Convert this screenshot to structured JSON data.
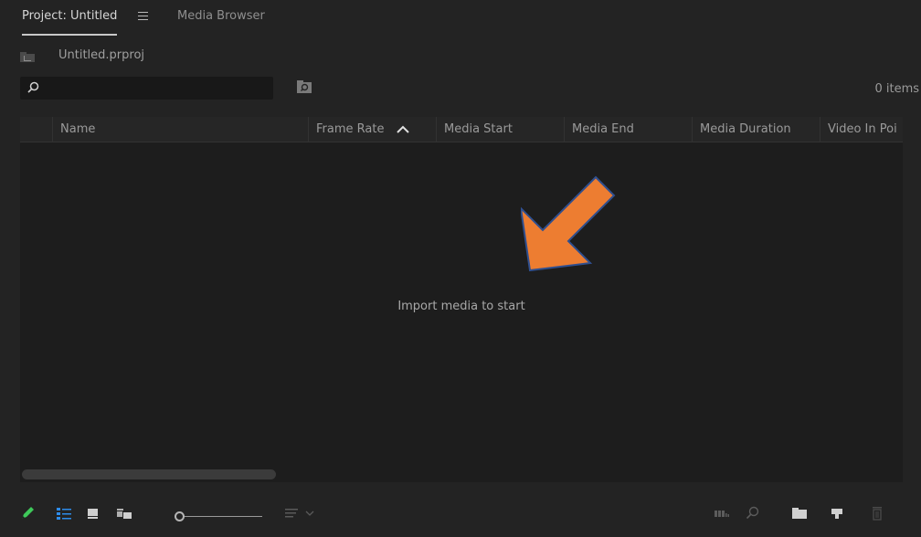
{
  "tabs": {
    "project_label": "Project: Untitled",
    "media_browser_label": "Media Browser"
  },
  "breadcrumb": {
    "project_file": "Untitled.prproj"
  },
  "search": {
    "value": "",
    "placeholder": ""
  },
  "items_count": "0 items",
  "columns": {
    "name": "Name",
    "frame_rate": "Frame Rate",
    "media_start": "Media Start",
    "media_end": "Media End",
    "media_duration": "Media Duration",
    "video_in_point": "Video In Poi"
  },
  "sort": {
    "column": "Frame Rate",
    "direction": "ascending"
  },
  "empty_message": "Import media to start",
  "annotation": {
    "icon": "arrow-down-left",
    "color": "#ed7d31",
    "outline": "#2f4f8f"
  },
  "toolbar": {
    "icons": [
      "pencil-icon",
      "list-view-icon",
      "icon-view-icon",
      "freeform-view-icon",
      "zoom-slider",
      "sort-icons-icon",
      "automate-to-sequence-icon",
      "find-icon",
      "new-bin-icon",
      "new-item-icon",
      "trash-icon"
    ],
    "zoom_level": 0
  },
  "colors": {
    "background": "#232323",
    "list_background": "#1d1d1d",
    "accent_green": "#3ec95a",
    "accent_blue": "#2d8ceb"
  }
}
